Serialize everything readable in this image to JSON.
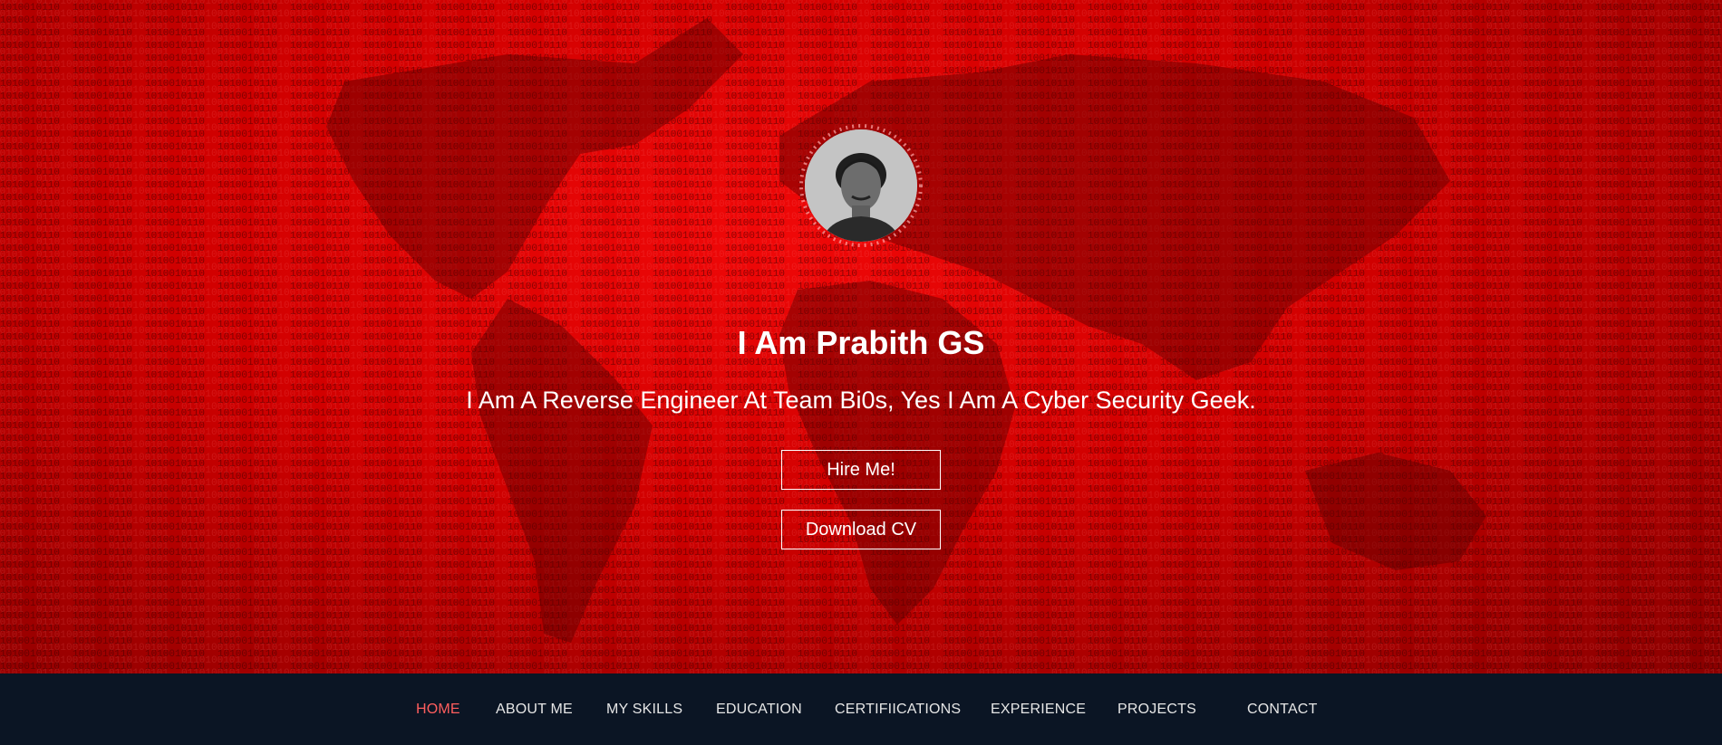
{
  "hero": {
    "title": "I Am Prabith GS",
    "subtitle": "I Am A Reverse Engineer At Team Bi0s, Yes I Am A Cyber Security Geek.",
    "avatar_icon": "person-portrait",
    "background": "red binary-code world map"
  },
  "buttons": {
    "hire_label": "Hire Me!",
    "cv_label": "Download CV"
  },
  "nav": {
    "items": [
      {
        "label": "HOME",
        "active": true
      },
      {
        "label": "ABOUT ME",
        "active": false
      },
      {
        "label": "MY SKILLS",
        "active": false
      },
      {
        "label": "EDUCATION",
        "active": false
      },
      {
        "label": "CERTIFIICATIONS",
        "active": false
      },
      {
        "label": "EXPERIENCE",
        "active": false
      },
      {
        "label": "PROJECTS",
        "active": false
      },
      {
        "label": "CONTACT",
        "active": false
      }
    ]
  },
  "colors": {
    "hero_red": "#d00000",
    "nav_bg": "#0b1524",
    "nav_active": "#ff5e5e",
    "text": "#ffffff"
  }
}
